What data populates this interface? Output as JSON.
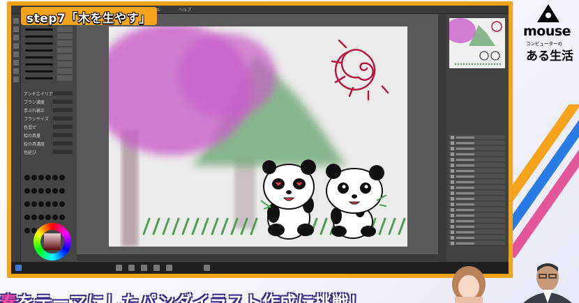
{
  "badge": {
    "text": "step7「木を生やす」"
  },
  "logo": {
    "brand": "mouse",
    "subtitle": "コンピューターの",
    "tagline": "ある生活"
  },
  "caption": {
    "lead": "春",
    "text": "をテーマにしたパンダイラスト作成に挑戦！"
  },
  "app": {
    "left_panel_labels": [
      "アンチエイリアス",
      "ブラシ濃度",
      "手ぶれ補正",
      "ブラシサイズ",
      "色混ぜ",
      "絵の具量",
      "絵の具濃度",
      "色延び"
    ],
    "panels": [
      "ナビゲーター",
      "カラーサークル",
      "レイヤー",
      "ブラシサイズ"
    ]
  },
  "colors": {
    "frame": "#f6a31c",
    "tree_foliage": "#c95fc9",
    "tree_green": "#6fa876",
    "sun": "#b81840",
    "grass": "#4f9e55",
    "caption_outline": "#3b2a8a"
  },
  "icons": [
    "tool-icon",
    "brush-icon",
    "eye-icon",
    "color-wheel-icon"
  ]
}
